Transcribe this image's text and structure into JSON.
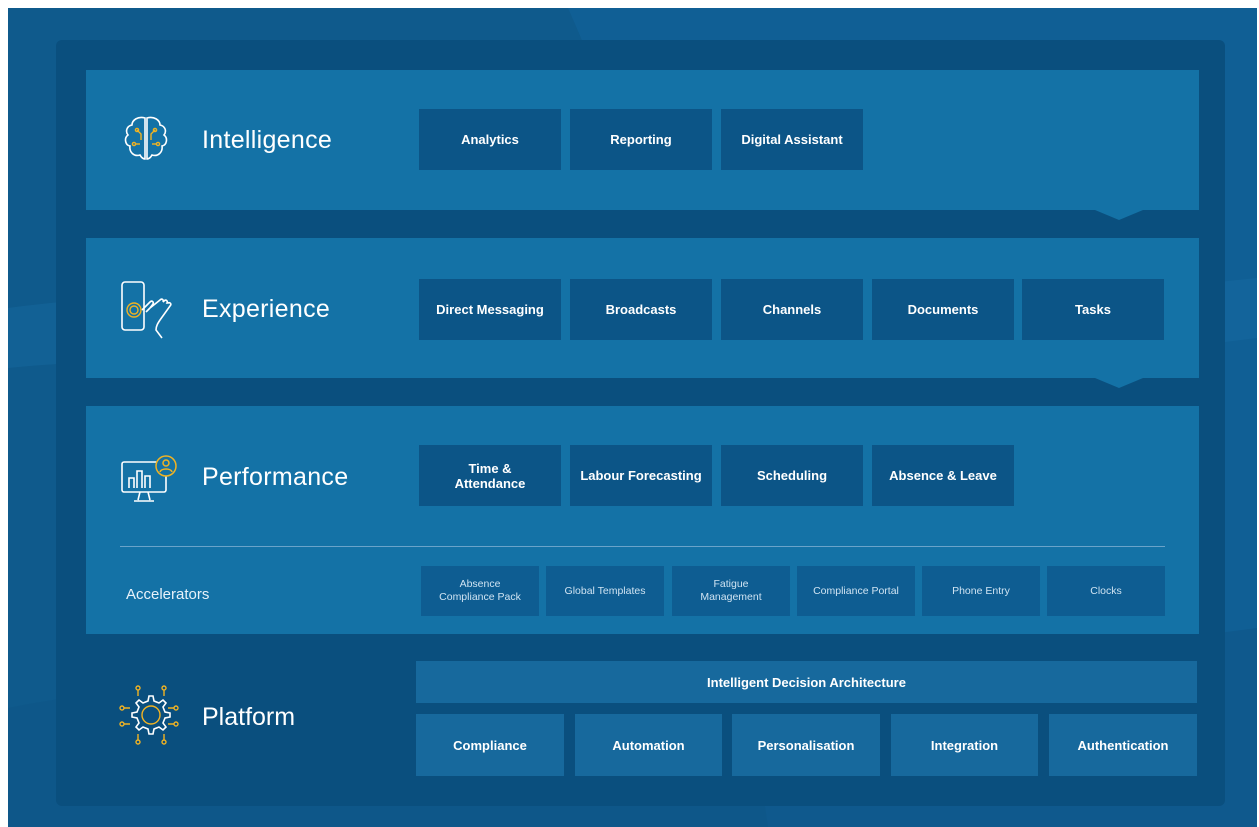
{
  "colors": {
    "background": "#0f5a8c",
    "frame": "#0a4f7e",
    "layer": "#1472a6",
    "tile": "#0c5587",
    "accent": "#f0b323"
  },
  "layers": [
    {
      "title": "Intelligence",
      "icon": "brain-circuit-icon",
      "tiles": [
        "Analytics",
        "Reporting",
        "Digital Assistant"
      ]
    },
    {
      "title": "Experience",
      "icon": "touch-phone-icon",
      "tiles": [
        "Direct Messaging",
        "Broadcasts",
        "Channels",
        "Documents",
        "Tasks"
      ]
    },
    {
      "title": "Performance",
      "icon": "monitor-chart-user-icon",
      "tiles": [
        "Time & Attendance",
        "Labour Forecasting",
        "Scheduling",
        "Absence & Leave"
      ],
      "accelerators": {
        "label": "Accelerators",
        "tiles": [
          "Absence Compliance Pack",
          "Global Templates",
          "Fatigue Management",
          "Compliance Portal",
          "Phone Entry",
          "Clocks"
        ]
      }
    }
  ],
  "platform": {
    "title": "Platform",
    "icon": "gear-circuit-icon",
    "banner": "Intelligent Decision Architecture",
    "tiles": [
      "Compliance",
      "Automation",
      "Personalisation",
      "Integration",
      "Authentication"
    ]
  }
}
